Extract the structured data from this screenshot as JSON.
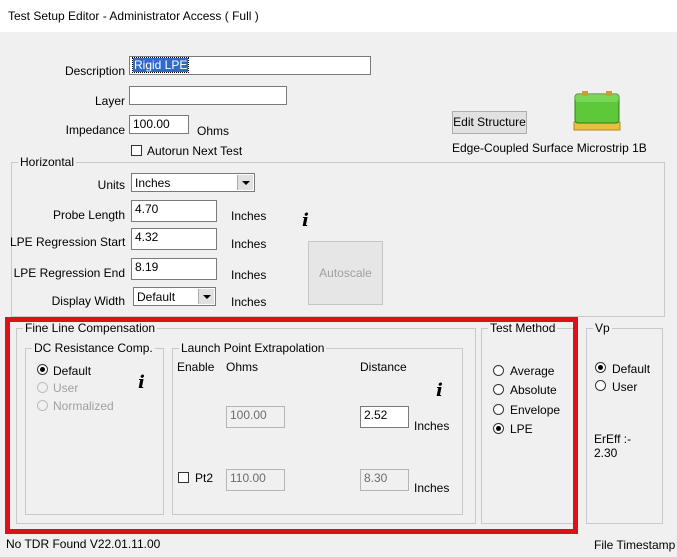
{
  "window": {
    "title": "Test Setup Editor - Administrator Access ( Full )"
  },
  "form": {
    "description_label": "Description",
    "description_value": "Rigid LPE",
    "layer_label": "Layer",
    "layer_value": "",
    "impedance_label": "Impedance",
    "impedance_value": "100.00",
    "impedance_unit": "Ohms",
    "autorun_label": "Autorun Next Test",
    "autorun_checked": false,
    "edit_structure_label": "Edit Structure",
    "structure_name": "Edge-Coupled Surface Microstrip 1B",
    "structure_icon": "green-pcb-structure-icon"
  },
  "horizontal": {
    "title": "Horizontal",
    "units_label": "Units",
    "units_value": "Inches",
    "probe_length_label": "Probe Length",
    "probe_length_value": "4.70",
    "lpe_start_label": "LPE Regression Start",
    "lpe_start_value": "4.32",
    "lpe_end_label": "LPE Regression End",
    "lpe_end_value": "8.19",
    "display_width_label": "Display Width",
    "display_width_value": "Default",
    "unit": "Inches",
    "info_glyph": "i",
    "autoscale_label": "Autoscale"
  },
  "flc": {
    "title": "Fine Line Compensation",
    "dc": {
      "title": "DC Resistance Comp.",
      "options": [
        "Default",
        "User",
        "Normalized"
      ],
      "selected": "Default",
      "info_glyph": "i"
    },
    "lpe": {
      "title": "Launch Point Extrapolation",
      "enable_header": "Enable",
      "ohms_header": "Ohms",
      "distance_header": "Distance",
      "info_glyph": "i",
      "row1_ohms": "100.00",
      "row1_distance": "2.52",
      "row1_unit": "Inches",
      "pt2_label": "Pt2",
      "pt2_checked": false,
      "row2_ohms": "110.00",
      "row2_distance": "8.30",
      "row2_unit": "Inches"
    }
  },
  "test_method": {
    "title": "Test Method",
    "options": [
      "Average",
      "Absolute",
      "Envelope",
      "LPE"
    ],
    "selected": "LPE"
  },
  "vp": {
    "title": "Vp",
    "options": [
      "Default",
      "User"
    ],
    "selected": "Default",
    "ereff_label": "ErEff :-",
    "ereff_value": "2.30"
  },
  "status": {
    "left": "No TDR Found  V22.01.11.00",
    "right": "File Timestamp :-"
  },
  "colors": {
    "highlight_border": "#e0101a",
    "selection": "#316ac5",
    "structure_green": "#5cc83a"
  }
}
